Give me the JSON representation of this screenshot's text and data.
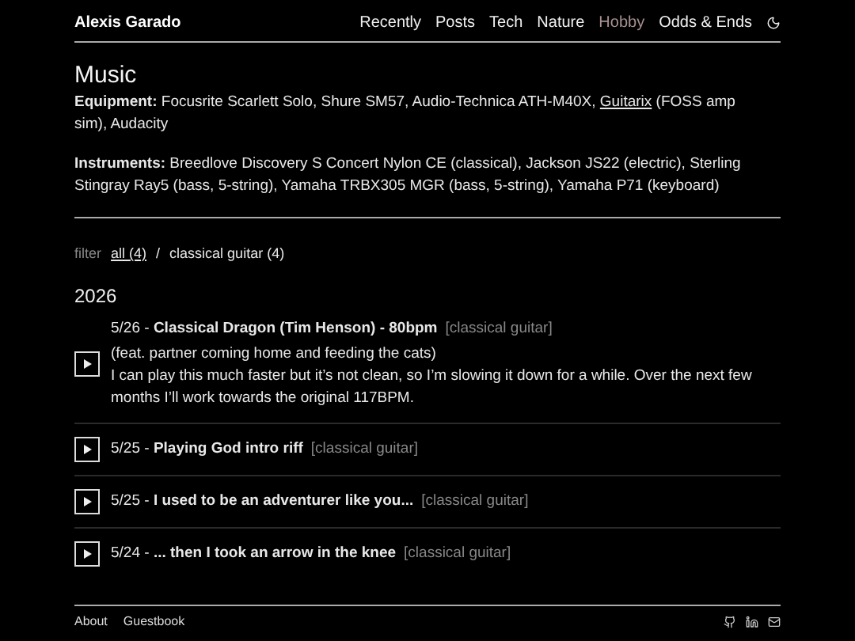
{
  "site_title": "Alexis Garado",
  "nav": [
    {
      "label": "Recently",
      "selected": false
    },
    {
      "label": "Posts",
      "selected": false
    },
    {
      "label": "Tech",
      "selected": false
    },
    {
      "label": "Nature",
      "selected": false
    },
    {
      "label": "Hobby",
      "selected": true
    },
    {
      "label": "Odds & Ends",
      "selected": false
    }
  ],
  "page_title": "Music",
  "equipment": {
    "before": "**Equipment:** Focusrite Scarlett Solo, Shure SM57, Audio-Technica ATH-M40X, ",
    "link": "Guitarix",
    "after": " (FOSS amp sim), Audacity"
  },
  "instruments": "**Instruments:** Breedlove Discovery S Concert Nylon CE (classical), Jackson JS22 (electric), Sterling Stingray Ray5 (bass, 5-string), Yamaha TRBX305 MGR (bass, 5-string), Yamaha P71 (keyboard)",
  "filter": {
    "label": "filter",
    "separator": "/",
    "options": [
      {
        "label": "all (4)",
        "selected": true
      },
      {
        "label": "classical guitar (4)",
        "selected": false
      }
    ]
  },
  "year": "2026",
  "entries": [
    {
      "heading": "5/26 - **Classical Dragon (Tim Henson) - 80bpm**",
      "tag": "[classical guitar]",
      "note": "(feat. partner coming home and feeding the cats)",
      "description": "I can play this much faster but it’s not clean, so I’m slowing it down for a while. Over the next few months I’ll work towards the original 117BPM."
    },
    {
      "heading": "5/25 - **Playing God intro riff**",
      "tag": "[classical guitar]"
    },
    {
      "heading": "5/25 - **I used to be an adventurer like you...**",
      "tag": "[classical guitar]"
    },
    {
      "heading": "5/24 - **... then I took an arrow in the knee**",
      "tag": "[classical guitar]"
    }
  ],
  "footer_links": [
    "About",
    "Guestbook"
  ]
}
